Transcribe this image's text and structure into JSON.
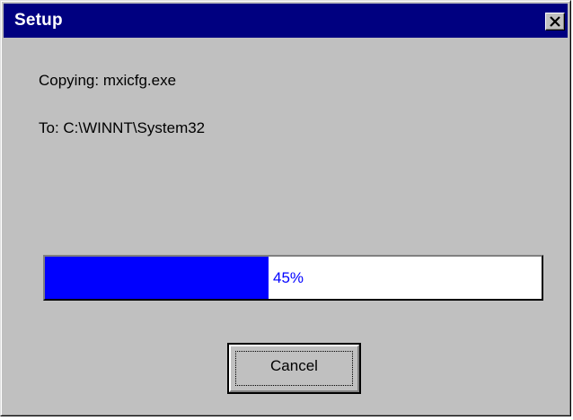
{
  "window": {
    "title": "Setup"
  },
  "status": {
    "copying_text": "Copying: mxicfg.exe",
    "destination_text": "To: C:\\WINNT\\System32"
  },
  "progress": {
    "percent": 45,
    "label": "45%"
  },
  "buttons": {
    "cancel_label": "Cancel",
    "close_icon": "close-x-icon"
  },
  "colors": {
    "titlebar": "#000080",
    "progress_fill": "#0000ff",
    "window_face": "#c0c0c0"
  }
}
